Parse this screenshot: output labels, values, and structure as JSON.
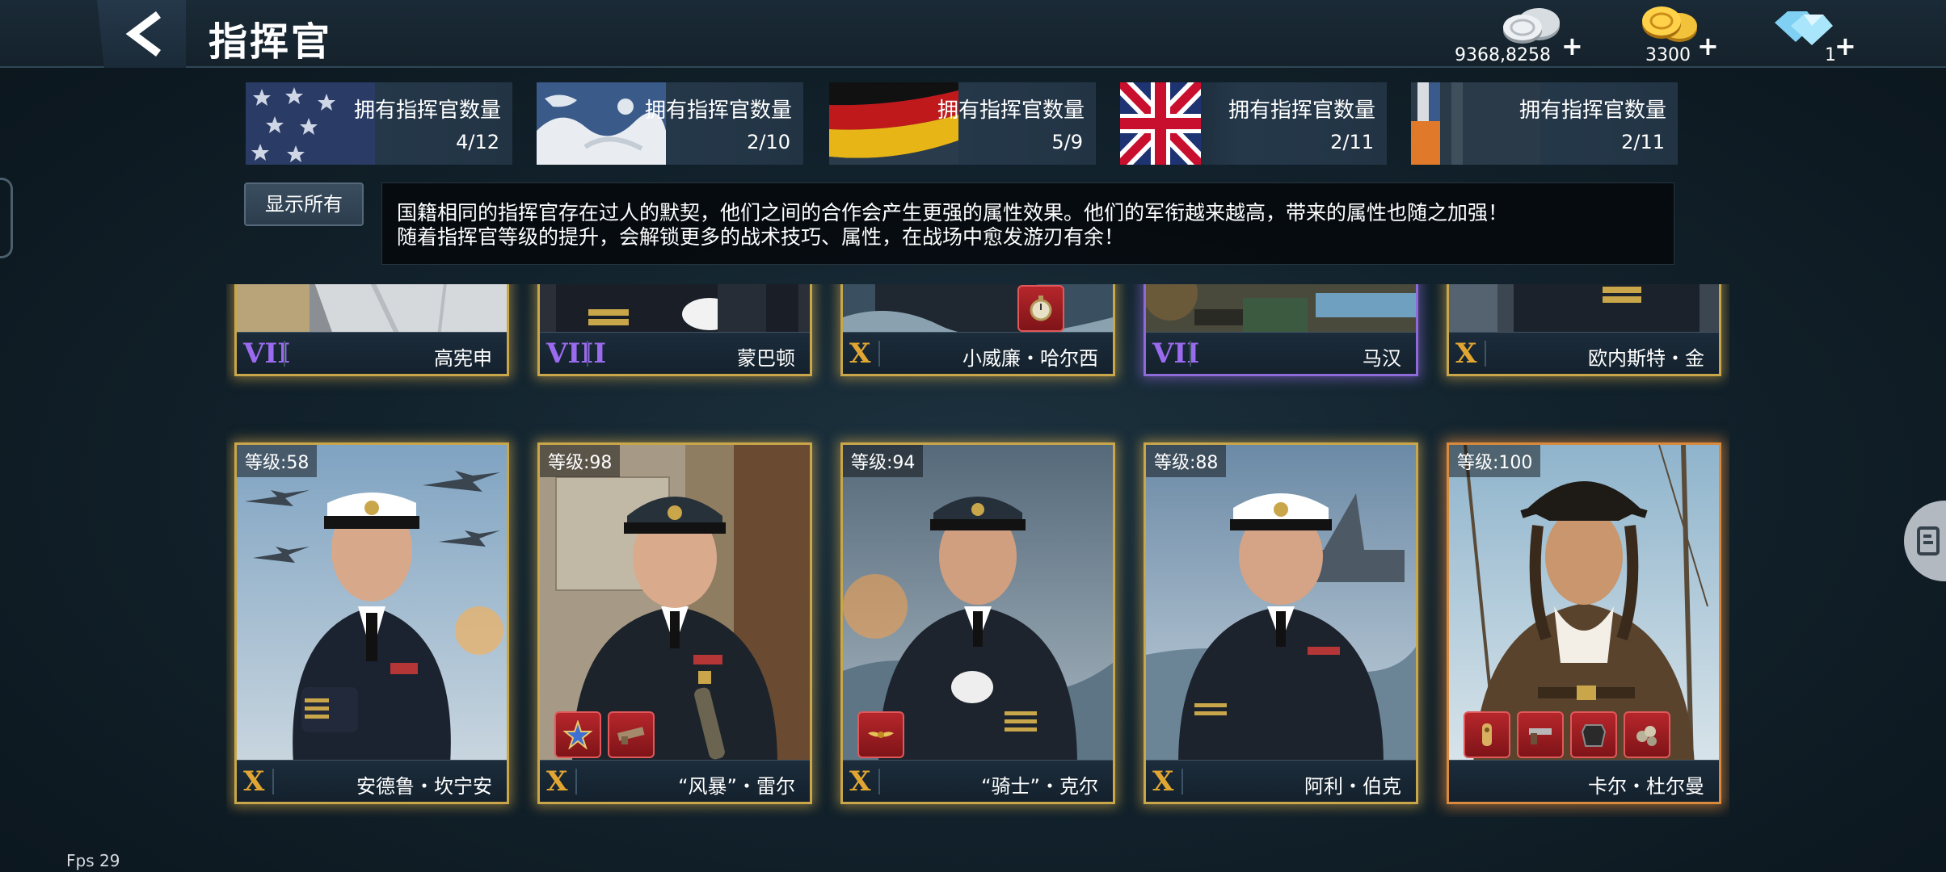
{
  "header": {
    "title": "指挥官",
    "currencies": [
      {
        "icon": "silver-coin-icon",
        "amount": "9368,8258"
      },
      {
        "icon": "gold-coin-icon",
        "amount": "3300"
      },
      {
        "icon": "diamond-icon",
        "amount": "1"
      }
    ]
  },
  "nations": [
    {
      "flag": "usa-flag-icon",
      "label": "拥有指挥官数量",
      "count": "4/12"
    },
    {
      "flag": "japan-flag-icon",
      "label": "拥有指挥官数量",
      "count": "2/10"
    },
    {
      "flag": "germany-flag-icon",
      "label": "拥有指挥官数量",
      "count": "5/9"
    },
    {
      "flag": "uk-flag-icon",
      "label": "拥有指挥官数量",
      "count": "2/11"
    },
    {
      "flag": "other-flag-icon",
      "label": "拥有指挥官数量",
      "count": "2/11"
    }
  ],
  "filter": {
    "show_all_label": "显示所有"
  },
  "info": {
    "line1": "国籍相同的指挥官存在过人的默契，他们之间的合作会产生更强的属性效果。他们的军衔越来越高，带来的属性也随之加强！",
    "line2": "随着指挥官等级的提升，会解锁更多的战术技巧、属性，在战场中愈发游刃有余！"
  },
  "row1": [
    {
      "rank": "VII",
      "name": "高宪申"
    },
    {
      "rank": "VIII",
      "name": "蒙巴顿"
    },
    {
      "rank": "X",
      "name": "小威廉・哈尔西"
    },
    {
      "rank": "VII",
      "name": "马汉"
    },
    {
      "rank": "X",
      "name": "欧内斯特・金"
    }
  ],
  "row2": [
    {
      "level": "等级:58",
      "rank": "X",
      "name": "安德鲁・坎宁安"
    },
    {
      "level": "等级:98",
      "rank": "X",
      "name": "“风暴”・雷尔"
    },
    {
      "level": "等级:94",
      "rank": "X",
      "name": "“骑士”・克尔"
    },
    {
      "level": "等级:88",
      "rank": "X",
      "name": "阿利・伯克"
    },
    {
      "level": "等级:100",
      "rank": "X",
      "name": "卡尔・杜尔曼"
    }
  ],
  "footer": {
    "fps": "Fps 29"
  },
  "colors": {
    "gold_frame": "#c9a64a",
    "purple_frame": "#8e6ad8",
    "legend_frame": "#d98a3c",
    "gear_red": "#b6262b"
  }
}
